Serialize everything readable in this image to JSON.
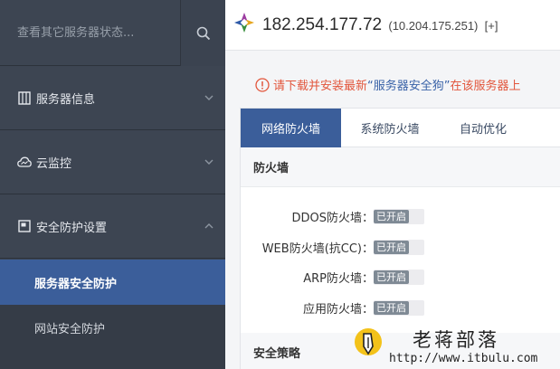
{
  "sidebar": {
    "search": {
      "placeholder": "查看其它服务器状态..."
    },
    "menu": [
      {
        "label": "服务器信息",
        "icon": "server-icon"
      },
      {
        "label": "云监控",
        "icon": "cloud-icon"
      },
      {
        "label": "安全防护设置",
        "icon": "shield-panel-icon"
      }
    ],
    "submenu": [
      {
        "label": "服务器安全防护",
        "active": true
      },
      {
        "label": "网站安全防护",
        "active": false
      }
    ]
  },
  "header": {
    "ip": "182.254.177.72",
    "private_ip": "(10.204.175.251)",
    "expand": "[+]"
  },
  "notice": {
    "text": "请下载并安装最新",
    "link": "“服务器安全狗”",
    "suffix": "在该服务器上"
  },
  "tabs": [
    {
      "label": "网络防火墙",
      "active": true
    },
    {
      "label": "系统防火墙",
      "active": false
    },
    {
      "label": "自动优化",
      "active": false
    }
  ],
  "firewall": {
    "title": "防火墙",
    "rows": [
      {
        "label": "DDOS防火墙：",
        "status": "已开启"
      },
      {
        "label": "WEB防火墙(抗CC)：",
        "status": "已开启"
      },
      {
        "label": "ARP防火墙：",
        "status": "已开启"
      },
      {
        "label": "应用防火墙：",
        "status": "已开启"
      }
    ]
  },
  "policy": {
    "title": "安全策略"
  },
  "watermark": {
    "title": "老蒋部落",
    "url": "http://www.itbulu.com"
  },
  "colors": {
    "sidebar": "#3d4552",
    "accent": "#3b5e9a",
    "warning": "#e2563c",
    "link": "#3a63a8"
  }
}
